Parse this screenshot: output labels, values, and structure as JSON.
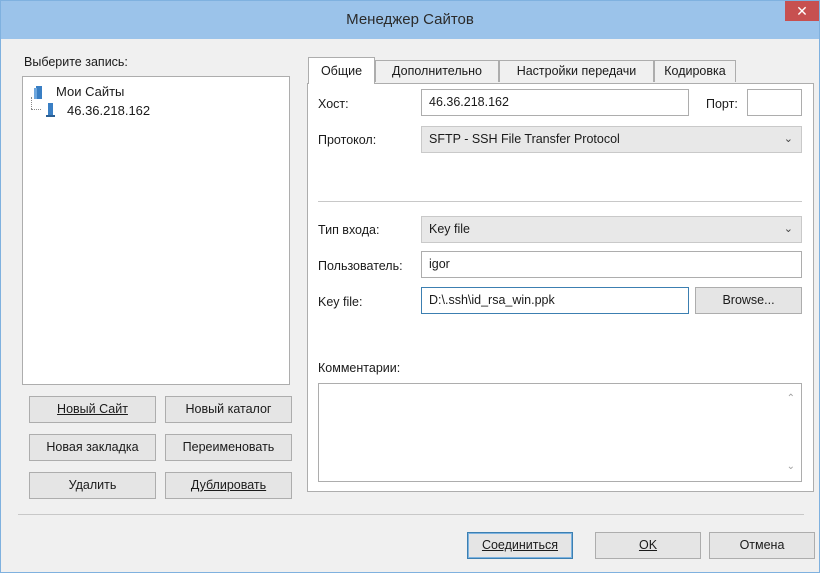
{
  "window": {
    "title": "Менеджер Сайтов",
    "close": "✕"
  },
  "left": {
    "select_label": "Выберите запись:",
    "tree_root": "Мои Сайты",
    "tree_child": "46.36.218.162",
    "buttons": {
      "new_site": "Новый Сайт",
      "new_folder": "Новый каталог",
      "new_bookmark": "Новая закладка",
      "rename": "Переименовать",
      "delete": "Удалить",
      "duplicate": "Дублировать"
    }
  },
  "tabs": [
    "Общие",
    "Дополнительно",
    "Настройки передачи",
    "Кодировка"
  ],
  "general": {
    "host_label": "Хост:",
    "host_value": "46.36.218.162",
    "port_label": "Порт:",
    "port_value": "",
    "protocol_label": "Протокол:",
    "protocol_value": "SFTP - SSH File Transfer Protocol",
    "logon_label": "Тип входа:",
    "logon_value": "Key file",
    "user_label": "Пользователь:",
    "user_value": "igor",
    "keyfile_label": "Key file:",
    "keyfile_value": "D:\\.ssh\\id_rsa_win.ppk",
    "browse": "Browse...",
    "comments_label": "Комментарии:"
  },
  "footer": {
    "connect": "Соединиться",
    "ok": "OK",
    "cancel": "Отмена"
  },
  "icons": {
    "folder": "folder-icon",
    "server": "server-icon",
    "chevron": "chevron-down-icon"
  },
  "colors": {
    "titlebar": "#9bc3ea",
    "close": "#c75050",
    "accent": "#3c7fb1"
  }
}
